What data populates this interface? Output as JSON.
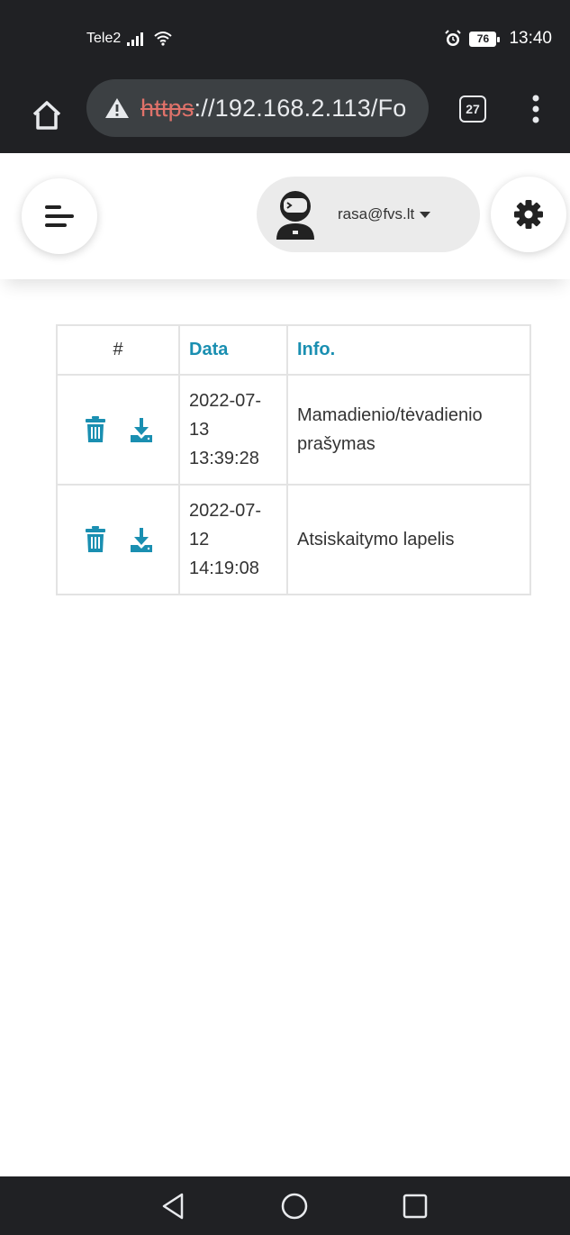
{
  "status_bar": {
    "carrier": "Tele2",
    "battery": "76",
    "time": "13:40",
    "icons": [
      "signal-icon",
      "wifi-icon",
      "alarm-icon",
      "battery-icon"
    ]
  },
  "browser": {
    "url_scheme": "https",
    "url_rest": "://192.168.2.113/Fo",
    "tab_count": "27",
    "icons": [
      "home-icon",
      "warning-icon",
      "more-vert-icon"
    ]
  },
  "header": {
    "user_email": "rasa@fvs.lt",
    "icons": [
      "hamburger-menu-icon",
      "avatar-icon",
      "caret-down-icon",
      "gear-icon"
    ]
  },
  "table": {
    "headers": {
      "actions": "#",
      "date": "Data",
      "info": "Info."
    },
    "rows": [
      {
        "date_line1": "2022-07-",
        "date_line2": "13",
        "date_line3": "13:39:28",
        "info": "Mamadienio/tėvadienio prašymas"
      },
      {
        "date_line1": "2022-07-",
        "date_line2": "12",
        "date_line3": "14:19:08",
        "info": "Atsiskaitymo lapelis"
      }
    ],
    "row_icons": [
      "trash-icon",
      "download-icon"
    ]
  },
  "nav_bar": {
    "icons": [
      "back-icon",
      "home-circle-icon",
      "recents-icon"
    ]
  },
  "colors": {
    "accent": "#1a8fb1",
    "dark_bar": "#202124",
    "url_scheme_red": "#e0726a"
  }
}
